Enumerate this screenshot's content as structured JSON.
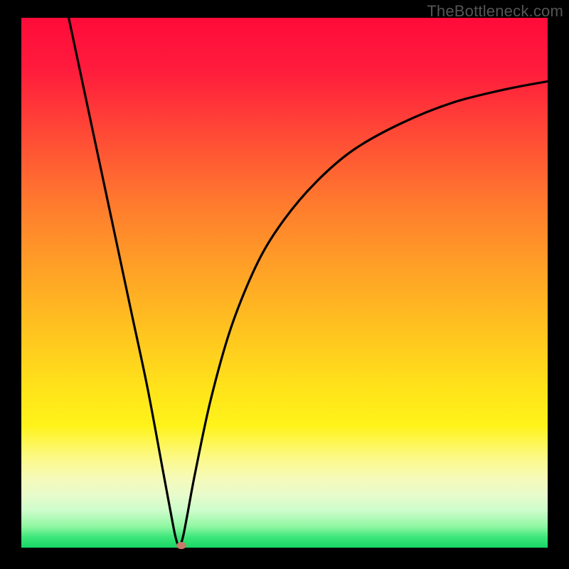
{
  "watermark": {
    "text": "TheBottleneck.com"
  },
  "chart_data": {
    "type": "line",
    "title": "",
    "xlabel": "",
    "ylabel": "",
    "xlim": [
      0,
      100
    ],
    "ylim": [
      0,
      100
    ],
    "grid": false,
    "legend": false,
    "series": [
      {
        "name": "bottleneck-curve",
        "x": [
          9,
          12,
          15,
          18,
          21,
          24,
          27,
          28.5,
          29.3,
          30,
          30.7,
          31.5,
          33,
          36,
          40,
          45,
          50,
          56,
          63,
          72,
          82,
          92,
          100
        ],
        "y": [
          100,
          86,
          72,
          58,
          44,
          30,
          14,
          6,
          2,
          0.2,
          2,
          6,
          14,
          28,
          42,
          54,
          62,
          69,
          75,
          80,
          84,
          86.5,
          88
        ]
      }
    ],
    "marker": {
      "x": 30.4,
      "y": 0.4,
      "color": "#c77b6b"
    },
    "background_gradient": {
      "top": "#ff0b3a",
      "mid": "#ffe31a",
      "bottom": "#16d765"
    }
  }
}
